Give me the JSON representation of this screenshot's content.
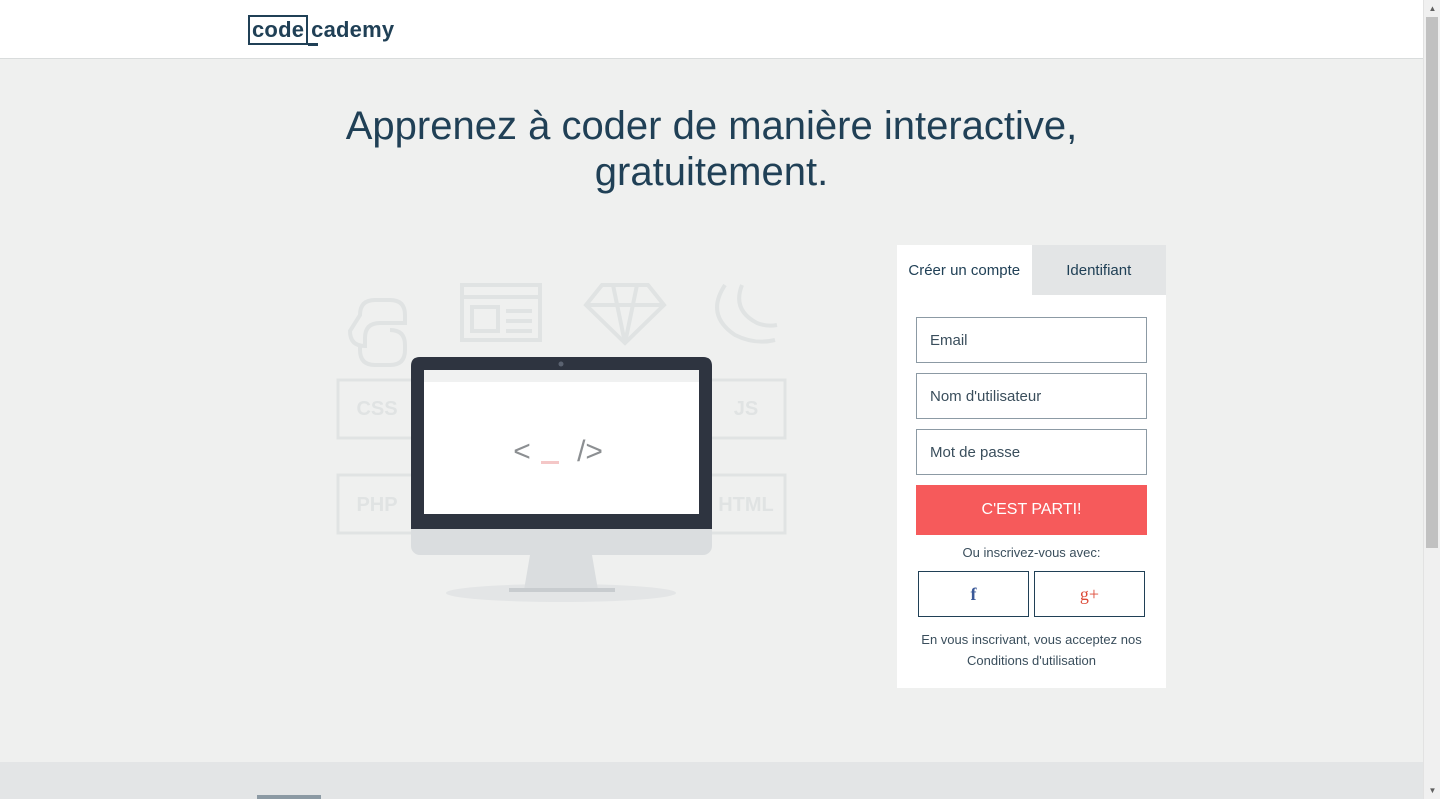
{
  "logo": {
    "box_text": "code",
    "rest_text": "cademy"
  },
  "hero": {
    "title_line1": "Apprenez à coder de manière interactive,",
    "title_line2": "gratuitement."
  },
  "illustration": {
    "language_labels": [
      "CSS",
      "JS",
      "PHP",
      "HTML"
    ],
    "screen_code": {
      "open": "<",
      "close": "/>"
    },
    "icons": [
      "python-icon",
      "webpage-icon",
      "ruby-icon",
      "jquery-icon"
    ]
  },
  "signup": {
    "tabs": [
      "Créer un compte",
      "Identifiant"
    ],
    "active_tab": 0,
    "email_placeholder": "Email",
    "username_placeholder": "Nom d'utilisateur",
    "password_placeholder": "Mot de passe",
    "submit_label": "C'EST PARTI!",
    "or_text": "Ou inscrivez-vous avec:",
    "facebook_glyph": "f",
    "google_glyph": "g+",
    "terms_text": "En vous inscrivant, vous acceptez nos",
    "terms_link": "Conditions d'utilisation"
  },
  "colors": {
    "accent": "#f65a5b",
    "navy": "#204056",
    "background": "#eff0ef",
    "facebook": "#3b5998",
    "google": "#dd4b39"
  },
  "scrollbar": {
    "up_glyph": "▲",
    "down_glyph": "▼"
  }
}
